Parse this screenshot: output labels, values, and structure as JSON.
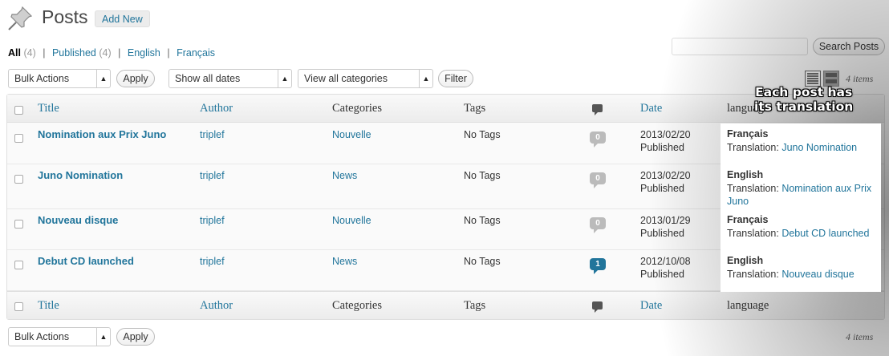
{
  "header": {
    "icon": "pushpin-icon",
    "title": "Posts",
    "add_new": "Add New"
  },
  "filters": {
    "all_label": "All",
    "all_count": "(4)",
    "published_label": "Published",
    "published_count": "(4)",
    "english": "English",
    "francais": "Français",
    "sep": "|"
  },
  "search": {
    "placeholder": "",
    "button": "Search Posts"
  },
  "toolbar": {
    "bulk_actions": "Bulk Actions",
    "apply": "Apply",
    "dates": "Show all dates",
    "categories": "View all categories",
    "filter": "Filter",
    "items_count": "4 items",
    "view_icons": [
      "list-view-icon",
      "excerpt-view-icon"
    ]
  },
  "table": {
    "columns": {
      "title": "Title",
      "author": "Author",
      "categories": "Categories",
      "tags": "Tags",
      "comments_icon": "comment-icon",
      "date": "Date",
      "language": "language"
    },
    "translation_prefix": "Translation:",
    "rows": [
      {
        "title": "Nomination aux Prix Juno",
        "author": "triplef",
        "category": "Nouvelle",
        "tags": "No Tags",
        "comments": "0",
        "date": "2013/02/20",
        "status": "Published",
        "language": "Français",
        "translation": "Juno Nomination"
      },
      {
        "title": "Juno Nomination",
        "author": "triplef",
        "category": "News",
        "tags": "No Tags",
        "comments": "0",
        "date": "2013/02/20",
        "status": "Published",
        "language": "English",
        "translation": "Nomination aux Prix Juno"
      },
      {
        "title": "Nouveau disque",
        "author": "triplef",
        "category": "Nouvelle",
        "tags": "No Tags",
        "comments": "0",
        "date": "2013/01/29",
        "status": "Published",
        "language": "Français",
        "translation": "Debut CD launched"
      },
      {
        "title": "Debut CD launched",
        "author": "triplef",
        "category": "News",
        "tags": "No Tags",
        "comments": "1",
        "date": "2012/10/08",
        "status": "Published",
        "language": "English",
        "translation": "Nouveau disque"
      }
    ]
  },
  "callout": {
    "line1": "Each post has",
    "line2": "its translation"
  },
  "colors": {
    "link": "#21759b",
    "bubble_zero": "#bbbbbb",
    "bubble_active": "#21759b"
  }
}
